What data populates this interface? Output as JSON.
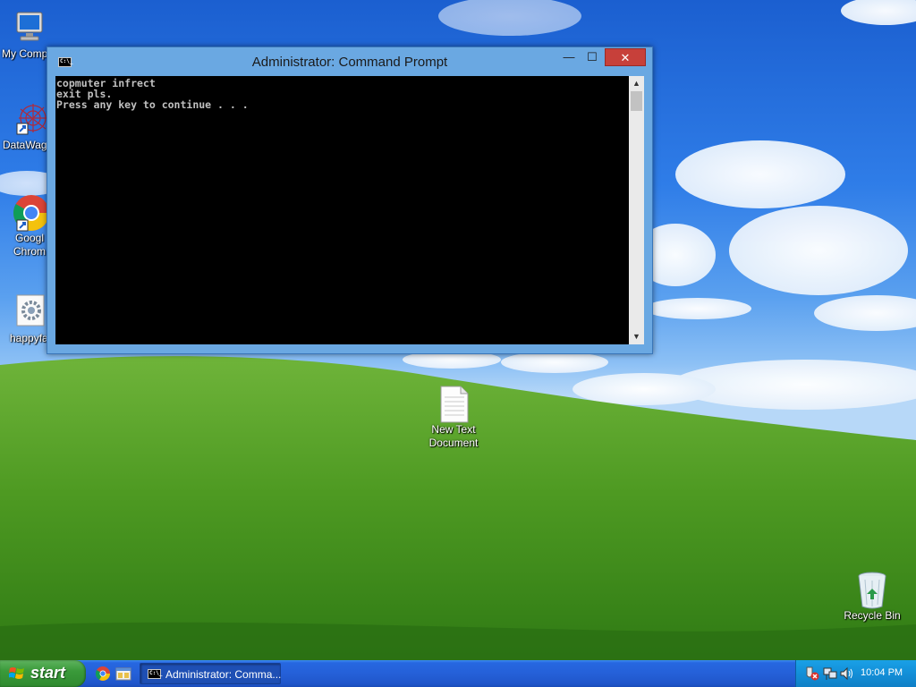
{
  "desktop": {
    "icons": [
      {
        "label": "My Comp",
        "icon": "computer-icon"
      },
      {
        "label": "DataWag",
        "icon": "datawag-icon"
      },
      {
        "label": "Googl",
        "label2": "Chrom",
        "icon": "chrome-icon"
      },
      {
        "label": "happyfa",
        "icon": "gear-file-icon"
      },
      {
        "label": "New Text",
        "label2": "Document",
        "icon": "text-document-icon"
      },
      {
        "label": "Recycle Bin",
        "icon": "recycle-bin-icon"
      }
    ]
  },
  "window": {
    "title": "Administrator:  Command Prompt",
    "controls": {
      "minimize": "—",
      "maximize": "☐",
      "close": "✕"
    },
    "icon_text": "C:\\_",
    "console_lines": [
      "copmuter infrect",
      "exit pls.",
      "Press any key to continue . . ."
    ],
    "scroll_up": "▲",
    "scroll_down": "▼"
  },
  "taskbar": {
    "start_label": "start",
    "quick_launch": [
      "chrome-icon",
      "explorer-icon"
    ],
    "task_item_label": "Administrator:  Comma...",
    "tray_icons": [
      "security-alert-icon",
      "network-icon",
      "volume-icon"
    ],
    "clock": "10:04 PM"
  },
  "colors": {
    "taskbar_blue": "#2560d8",
    "start_green": "#3a9a3a",
    "close_red": "#c7403a",
    "console_bg": "#000000",
    "console_fg": "#c0c0c0",
    "window_frame": "#6aa8e2"
  }
}
